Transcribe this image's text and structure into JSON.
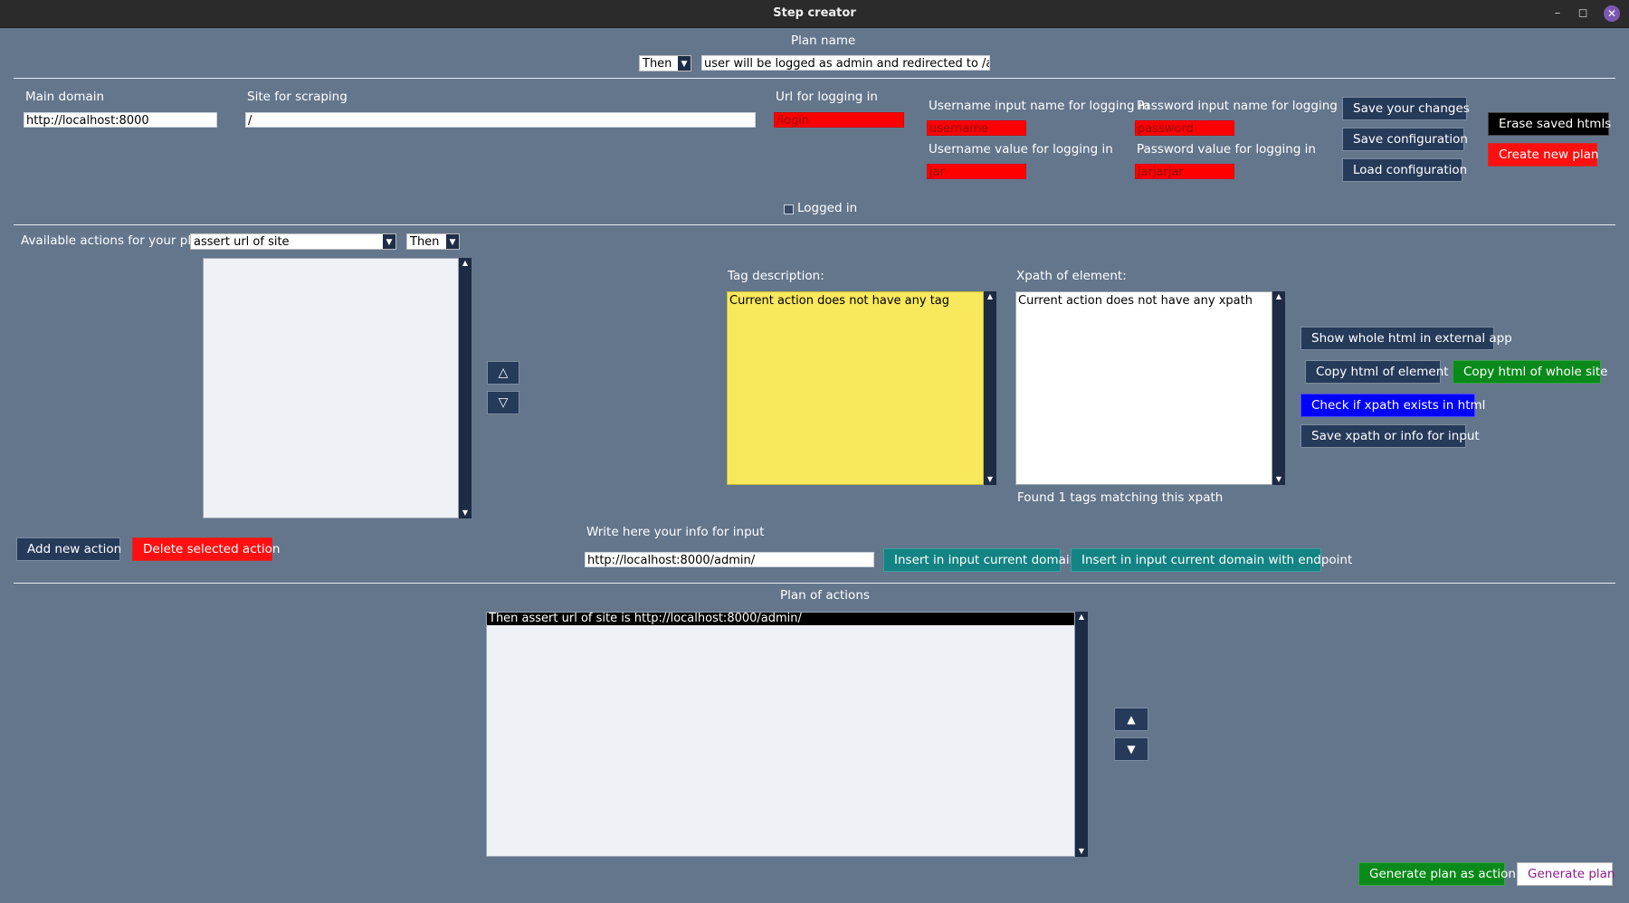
{
  "window": {
    "title": "Step creator",
    "minimize_glyph": "–",
    "maximize_glyph": "◻",
    "close_glyph": "✕"
  },
  "plan_name": {
    "label": "Plan name",
    "keyword": "Then",
    "value": "user will be logged as admin and redirected to /admin"
  },
  "config": {
    "main_domain_label": "Main domain",
    "main_domain_value": "http://localhost:8000",
    "site_label": "Site for scraping",
    "site_value": "/",
    "login_url_label": "Url for logging in",
    "login_url_value": "/login",
    "username_input_label": "Username input name for logging in",
    "username_input_value": "username",
    "password_input_label": "Password input name for logging in",
    "password_input_value": "password",
    "username_value_label": "Username value for logging in",
    "username_value_value": "jar",
    "password_value_label": "Password value for logging in",
    "password_value_value": "jarjarjar",
    "logged_in_label": "Logged in",
    "save_changes": "Save your changes",
    "save_configuration": "Save configuration",
    "load_configuration": "Load configuration",
    "erase_htmls": "Erase saved htmls",
    "create_plan": "Create new plan"
  },
  "actions": {
    "available_label": "Available actions for your plan",
    "selected_action": "assert url of site",
    "keyword": "Then",
    "move_up": "△",
    "move_down": "▽",
    "add_action": "Add new action",
    "delete_action": "Delete selected action"
  },
  "tag": {
    "label": "Tag description:",
    "text": "Current action does not have any tag"
  },
  "xpath": {
    "label": "Xpath of element:",
    "text": "Current action does not have any xpath",
    "found": "Found 1 tags matching this xpath"
  },
  "html_buttons": {
    "show_whole": "Show whole html in external app",
    "copy_element": "Copy html of element",
    "copy_site": "Copy html of whole site",
    "check_xpath": "Check if xpath exists in html",
    "save_xpath": "Save xpath or info for input"
  },
  "input_info": {
    "label": "Write here your info for input",
    "value": "http://localhost:8000/admin/",
    "insert_domain": "Insert in input current domain",
    "insert_domain_endpoint": "Insert in input current domain with endpoint"
  },
  "plan": {
    "label": "Plan of actions",
    "items": [
      "Then assert url of site is http://localhost:8000/admin/"
    ],
    "move_up": "▲",
    "move_down": "▼",
    "generate_action": "Generate plan as action",
    "generate": "Generate plan"
  },
  "scroll": {
    "up": "▲",
    "down": "▼",
    "combo_arrow": "▼"
  }
}
